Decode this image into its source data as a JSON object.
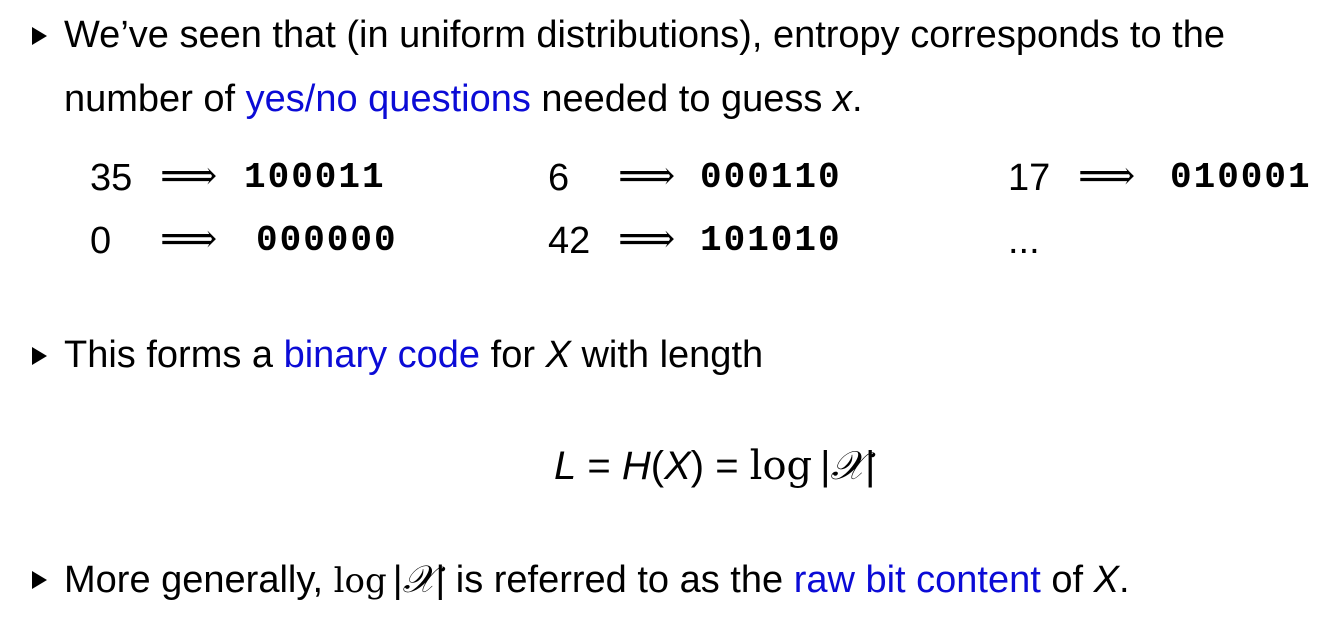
{
  "bullets": [
    {
      "line1": "We’ve seen that (in uniform distributions), entropy corresponds to the",
      "line2_pre": "number of ",
      "line2_link": "yes/no questions",
      "line2_post": " needed to guess ",
      "line2_var": "x",
      "line2_end": "."
    },
    {
      "pre": "This forms a ",
      "link": "binary code",
      "mid": " for ",
      "var": "X",
      "post": " with length"
    },
    {
      "pre": "More generally, ",
      "log": "log",
      "abs_open": "|",
      "calX": "𝒳",
      "abs_close": "|",
      "mid": " is referred to as the ",
      "link": "raw bit content",
      "post": " of ",
      "var": "X",
      "end": "."
    }
  ],
  "encodings": [
    {
      "num": "35",
      "arrow": "⟹",
      "bits": "100011"
    },
    {
      "num": "6",
      "arrow": "⟹",
      "bits": "000110"
    },
    {
      "num": "17",
      "arrow": "⟹",
      "bits": "010001"
    },
    {
      "num": "0",
      "arrow": "⟹",
      "bits": "000000"
    },
    {
      "num": "42",
      "arrow": "⟹",
      "bits": "101010"
    }
  ],
  "ellipsis": "...",
  "equation": {
    "L": "L",
    "eq1": " = ",
    "H": "H",
    "paren_open": "(",
    "X": "X",
    "paren_close": ")",
    "eq2": " = ",
    "log": "log",
    "abs_open": "|",
    "calX": "𝒳",
    "abs_close": "|"
  },
  "colors": {
    "link": "#0b0bd6",
    "text": "#000000"
  }
}
